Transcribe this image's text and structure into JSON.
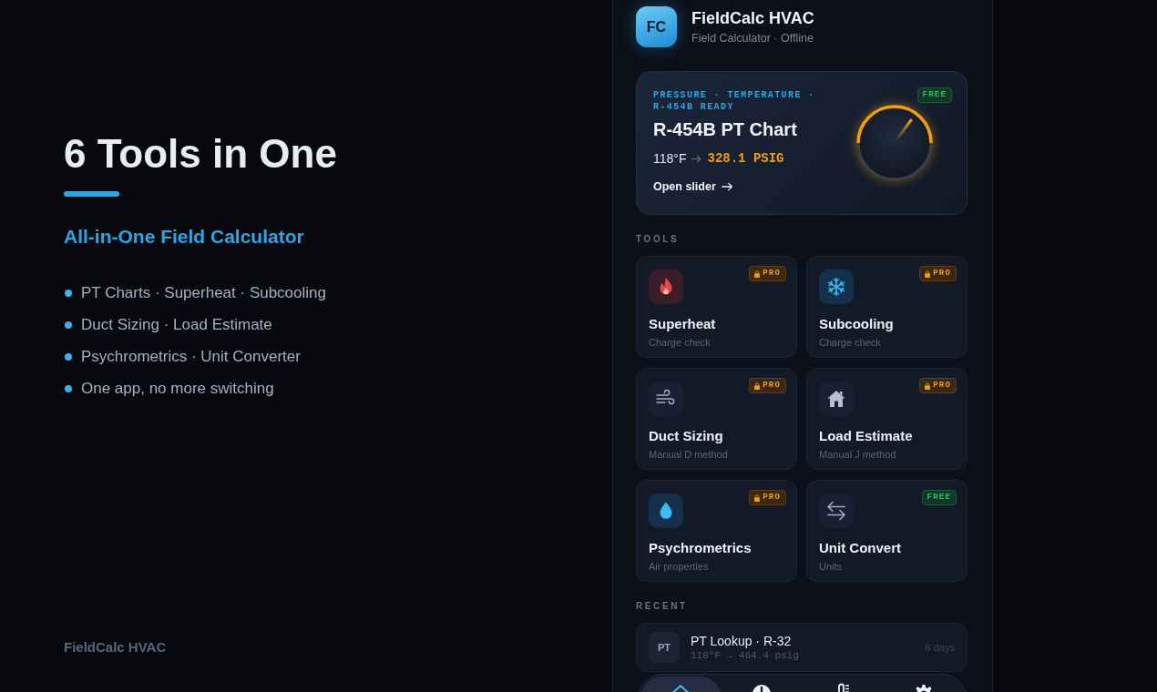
{
  "hero": {
    "title": "6 Tools in One",
    "subtitle": "All-in-One Field Calculator",
    "bullets": [
      "PT Charts · Superheat · Subcooling",
      "Duct Sizing · Load Estimate",
      "Psychrometrics · Unit Converter",
      "One app, no more switching"
    ],
    "footer": "FieldCalc HVAC"
  },
  "app": {
    "logo": "FC",
    "name": "FieldCalc HVAC",
    "status": "Field Calculator · Offline"
  },
  "feature_card": {
    "eyebrow": "PRESSURE · TEMPERATURE · R-454B READY",
    "badge": {
      "text": "FREE",
      "kind": "free"
    },
    "title": "R-454B PT Chart",
    "temperature": "118°F",
    "pressure": "328.1 PSIG",
    "link": "Open slider"
  },
  "tools_label": "TOOLS",
  "tools": [
    {
      "title": "Superheat",
      "subtitle": "Charge check",
      "badge": {
        "text": "PRO",
        "kind": "pro"
      }
    },
    {
      "title": "Subcooling",
      "subtitle": "Charge check",
      "badge": {
        "text": "PRO",
        "kind": "pro"
      }
    },
    {
      "title": "Duct Sizing",
      "subtitle": "Manual D method",
      "badge": {
        "text": "PRO",
        "kind": "pro"
      }
    },
    {
      "title": "Load Estimate",
      "subtitle": "Manual J method",
      "badge": {
        "text": "PRO",
        "kind": "pro"
      }
    },
    {
      "title": "Psychrometrics",
      "subtitle": "Air properties",
      "badge": {
        "text": "PRO",
        "kind": "pro"
      }
    },
    {
      "title": "Unit Convert",
      "subtitle": "Units",
      "badge": {
        "text": "FREE",
        "kind": "free"
      }
    }
  ],
  "recent_label": "RECENT",
  "recent": [
    {
      "tile": "PT",
      "title": "PT Lookup · R-32",
      "detail": "118°F → 464.4 psig",
      "time": "6 days"
    }
  ],
  "nav": [
    {
      "selected": true
    },
    {
      "selected": false
    },
    {
      "selected": false
    },
    {
      "selected": false
    }
  ]
}
